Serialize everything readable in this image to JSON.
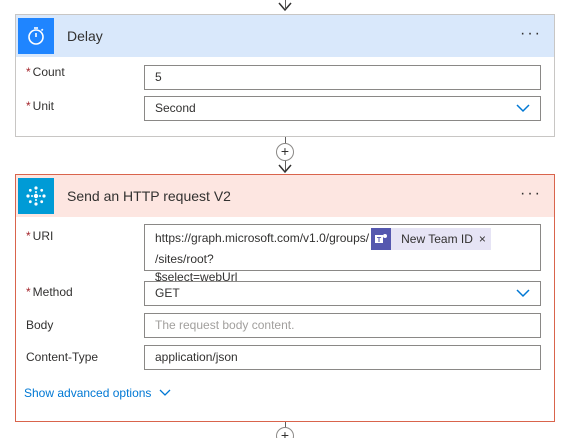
{
  "delay": {
    "title": "Delay",
    "icon": "timer-icon",
    "more": "···",
    "count_label": "Count",
    "count_value": "5",
    "unit_label": "Unit",
    "unit_value": "Second"
  },
  "http": {
    "title": "Send an HTTP request V2",
    "icon": "http-network-icon",
    "more": "···",
    "uri_label": "URI",
    "uri_prefix": "https://graph.microsoft.com/v1.0/groups/",
    "uri_token": "New Team ID",
    "uri_token_close": "×",
    "uri_suffix": "/sites/root?",
    "uri_line2": "$select=webUrl",
    "method_label": "Method",
    "method_value": "GET",
    "body_label": "Body",
    "body_placeholder": "The request body content.",
    "ctype_label": "Content-Type",
    "ctype_value": "application/json",
    "advanced_label": "Show advanced options"
  },
  "required_mark": "*",
  "plus": "+",
  "colors": {
    "delay_header": "#d9e8fb",
    "delay_icon": "#1f85ff",
    "http_header": "#fde6e1",
    "http_icon": "#009bd6",
    "http_border": "#d9644c",
    "link": "#0078d4",
    "required": "#a4262c"
  }
}
